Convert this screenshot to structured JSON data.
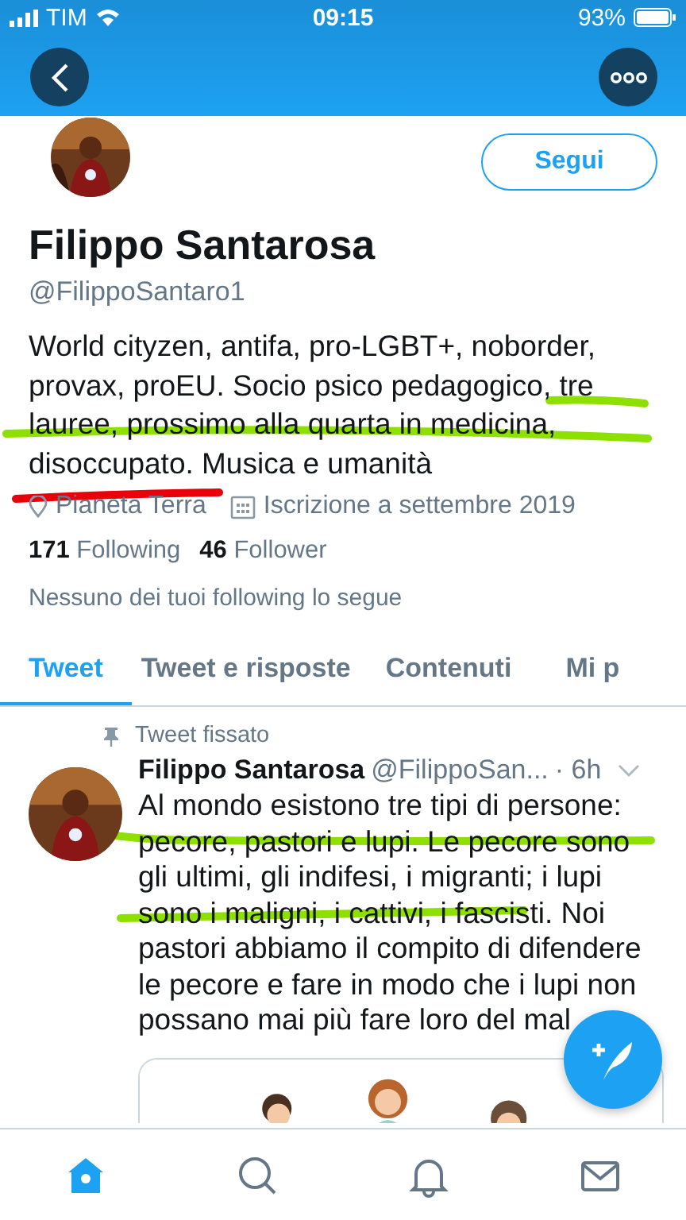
{
  "status_bar": {
    "carrier": "TIM",
    "time": "09:15",
    "battery": "93%"
  },
  "profile": {
    "name": "Filippo Santarosa",
    "handle": "@FilippoSantaro1",
    "bio": "World cityzen, antifa, pro-LGBT+, noborder, provax, proEU. Socio psico pedagogico, tre lauree, prossimo alla quarta in medicina, disoccupato. Musica e umanità",
    "location": "Pianeta Terra",
    "joined": "Iscrizione a settembre 2019",
    "following_count": "171",
    "following_label": "Following",
    "follower_count": "46",
    "follower_label": "Follower",
    "followed_by_note": "Nessuno dei tuoi following lo segue"
  },
  "follow_button": "Segui",
  "tabs": [
    {
      "label": "Tweet",
      "selected": true
    },
    {
      "label": "Tweet e risposte",
      "selected": false
    },
    {
      "label": "Contenuti",
      "selected": false
    },
    {
      "label": "Mi p",
      "selected": false
    }
  ],
  "pinned_tweet": {
    "pinned_label": "Tweet fissato",
    "name": "Filippo Santarosa",
    "handle": "@FilippoSan...",
    "time": "· 6h",
    "text": "Al mondo esistono tre tipi di persone: pecore, pastori e lupi. Le pecore sono gli ultimi, gli indifesi, i migranti; i lupi sono i maligni, i cattivi, i fascisti. Noi pastori abbiamo il compito di difendere le pecore e fare in modo che i lupi non possano mai più fare loro del mal"
  },
  "bottom_nav": [
    {
      "kind": "home",
      "selected": true
    },
    {
      "kind": "search",
      "selected": false
    },
    {
      "kind": "bell",
      "selected": false
    },
    {
      "kind": "mail",
      "selected": false
    }
  ],
  "marker_strokes": [
    {
      "color": "#8ee000"
    },
    {
      "color": "#8ee000"
    },
    {
      "color": "#e8000a"
    },
    {
      "color": "#8ee000"
    },
    {
      "color": "#8ee000"
    }
  ]
}
